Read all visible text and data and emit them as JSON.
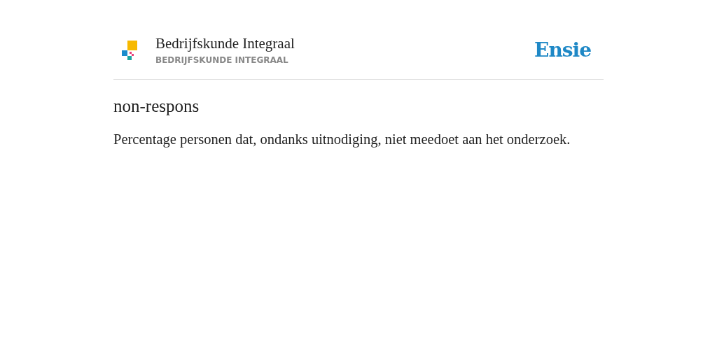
{
  "header": {
    "title": "Bedrijfskunde Integraal",
    "subtitle": "BEDRIJFSKUNDE INTEGRAAL",
    "brand": "Ensie"
  },
  "entry": {
    "term": "non-respons",
    "definition": "Percentage personen dat, ondanks uitnodiging, niet meedoet aan het onderzoek."
  }
}
